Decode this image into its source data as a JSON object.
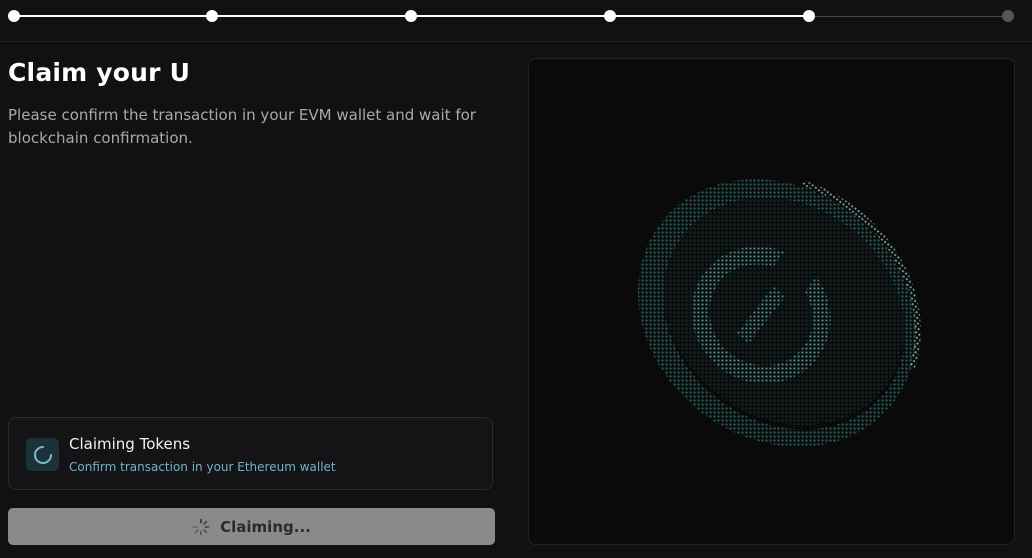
{
  "stepper": {
    "total_steps": 6,
    "completed_steps": 5
  },
  "header": {
    "title": "Claim your U",
    "subtitle": "Please confirm the transaction in your EVM wallet and wait for blockchain confirmation."
  },
  "status": {
    "title": "Claiming Tokens",
    "description": "Confirm transaction in your Ethereum wallet",
    "icon": "spinner-icon"
  },
  "action": {
    "label": "Claiming...",
    "icon": "spinner-icon"
  },
  "preview": {
    "icon": "coin-icon"
  },
  "colors": {
    "background": "#111113",
    "accent": "#6fb3c8",
    "coin_dots": "#2a6e6a",
    "button": "#8a8a8a"
  }
}
